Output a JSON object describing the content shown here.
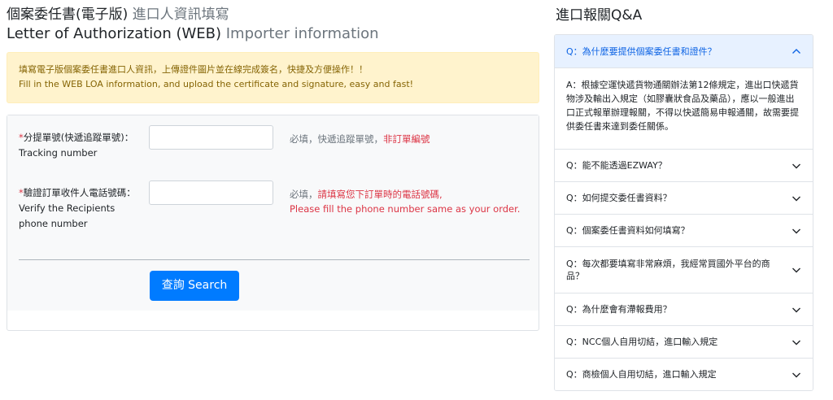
{
  "page": {
    "title_zh_main": "個案委任書(電子版)",
    "title_zh_sub": " 進口人資訊填寫",
    "title_en_main": "Letter of Authorization (WEB)",
    "title_en_sub": " Importer information"
  },
  "notice": {
    "line_zh": "填寫電子版個案委任書進口人資訊，上傳證件圖片並在線完成簽名，快捷及方便操作！！",
    "line_en": "Fill in the WEB LOA information, and upload the certificate and signature, easy and fast!"
  },
  "form": {
    "tracking": {
      "required_mark": "*",
      "label_zh": "分提單號(快遞追蹤單號)：",
      "label_en": "Tracking number",
      "value": "",
      "hint_gray": "必填，快遞追蹤單號，",
      "hint_red": "非訂單編號"
    },
    "phone": {
      "required_mark": "*",
      "label_zh": "驗證訂單收件人電話號碼：",
      "label_en": "Verify the Recipients phone number",
      "value": "",
      "hint_gray": "必填，",
      "hint_red": "請填寫您下訂單時的電話號碼,",
      "hint_red_en": "Please fill the phone number same as your order."
    },
    "search_button": "查詢 Search"
  },
  "qa": {
    "title": "進口報關Q&A",
    "items": [
      {
        "q": "Q：為什麼要提供個案委任書和證件？",
        "expanded": true,
        "a": "A：根據空運快遞貨物通關辦法第12條規定，進出口快遞貨物涉及輸出入規定（如膠囊狀食品及藥品），應以一般進出口正式報單辦理報關，不得以快遞簡易申報通關，故需要提供委任書來達到委任關係。"
      },
      {
        "q": "Q：能不能透過EZWAY？",
        "expanded": false
      },
      {
        "q": "Q：如何提交委任書資料？",
        "expanded": false
      },
      {
        "q": "Q：個案委任書資料如何填寫？",
        "expanded": false
      },
      {
        "q": "Q：每次都要填寫非常麻煩，我經常買國外平台的商品？",
        "expanded": false
      },
      {
        "q": "Q：為什麼會有滯報費用？",
        "expanded": false
      },
      {
        "q": "Q：NCC個人自用切結，進口輸入規定",
        "expanded": false
      },
      {
        "q": "Q：商檢個人自用切結，進口輸入規定",
        "expanded": false
      }
    ]
  },
  "colors": {
    "primary": "#007bff",
    "danger": "#dc3545",
    "notice_bg": "#fff3cd",
    "notice_text": "#856404",
    "active_header_bg": "#e7f1ff"
  },
  "icons": {
    "expanded": "chevron-up-icon",
    "collapsed": "chevron-down-icon"
  }
}
